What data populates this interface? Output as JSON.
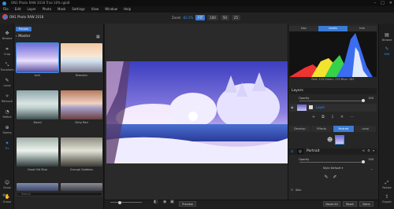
{
  "window": {
    "title": "ON1 Photo RAW 2018 Trial 16% rgb/8"
  },
  "menu": [
    "File",
    "Edit",
    "Layer",
    "Photo",
    "Mask",
    "Settings",
    "View",
    "Window",
    "Help"
  ],
  "toolbar": {
    "app_name": "ON1 Photo RAW 2018",
    "zoom_label": "Zoom",
    "zoom_value": "82.2%",
    "zoom_buttons": [
      "FIT",
      "100",
      "50",
      "25"
    ]
  },
  "left_tools": [
    "Browse",
    "Crop",
    "Transform",
    "Local",
    "Retouch",
    "Refine",
    "Stamp",
    "Fix",
    "Draw",
    "Erase"
  ],
  "browser": {
    "presets_label": "Presets",
    "section_title": "Master",
    "search_placeholder": "Search",
    "thumbs": [
      {
        "label": "Avril"
      },
      {
        "label": "Brandon"
      },
      {
        "label": "David"
      },
      {
        "label": "Dirty Red"
      },
      {
        "label": "Good Old Blue"
      },
      {
        "label": "Grunge Goddess"
      },
      {
        "label": "Heidi Ice"
      },
      {
        "label": "Jorg"
      }
    ]
  },
  "canvas": {
    "preview_label": "Preview"
  },
  "right": {
    "tabs": [
      "Nav",
      "Levels",
      "Info"
    ],
    "histogram_info": "Red: 129 Green: 175 Blue: 182",
    "layers_title": "Layers",
    "opacity_label": "Opacity",
    "opacity_value": "100",
    "layer_name": "Layer",
    "filter_tabs": [
      "Develop",
      "Effects",
      "Portrait",
      "Local"
    ],
    "portrait_title": "Portrait",
    "portrait_opacity_label": "Opacity",
    "portrait_opacity_value": "100",
    "style_label": "Style",
    "style_value": "Default",
    "skin_label": "Skin",
    "reset_all": "Reset All",
    "reset": "Reset",
    "done": "Done"
  },
  "right_nav": [
    "Browse",
    "Edit",
    "Resize",
    "Export"
  ]
}
